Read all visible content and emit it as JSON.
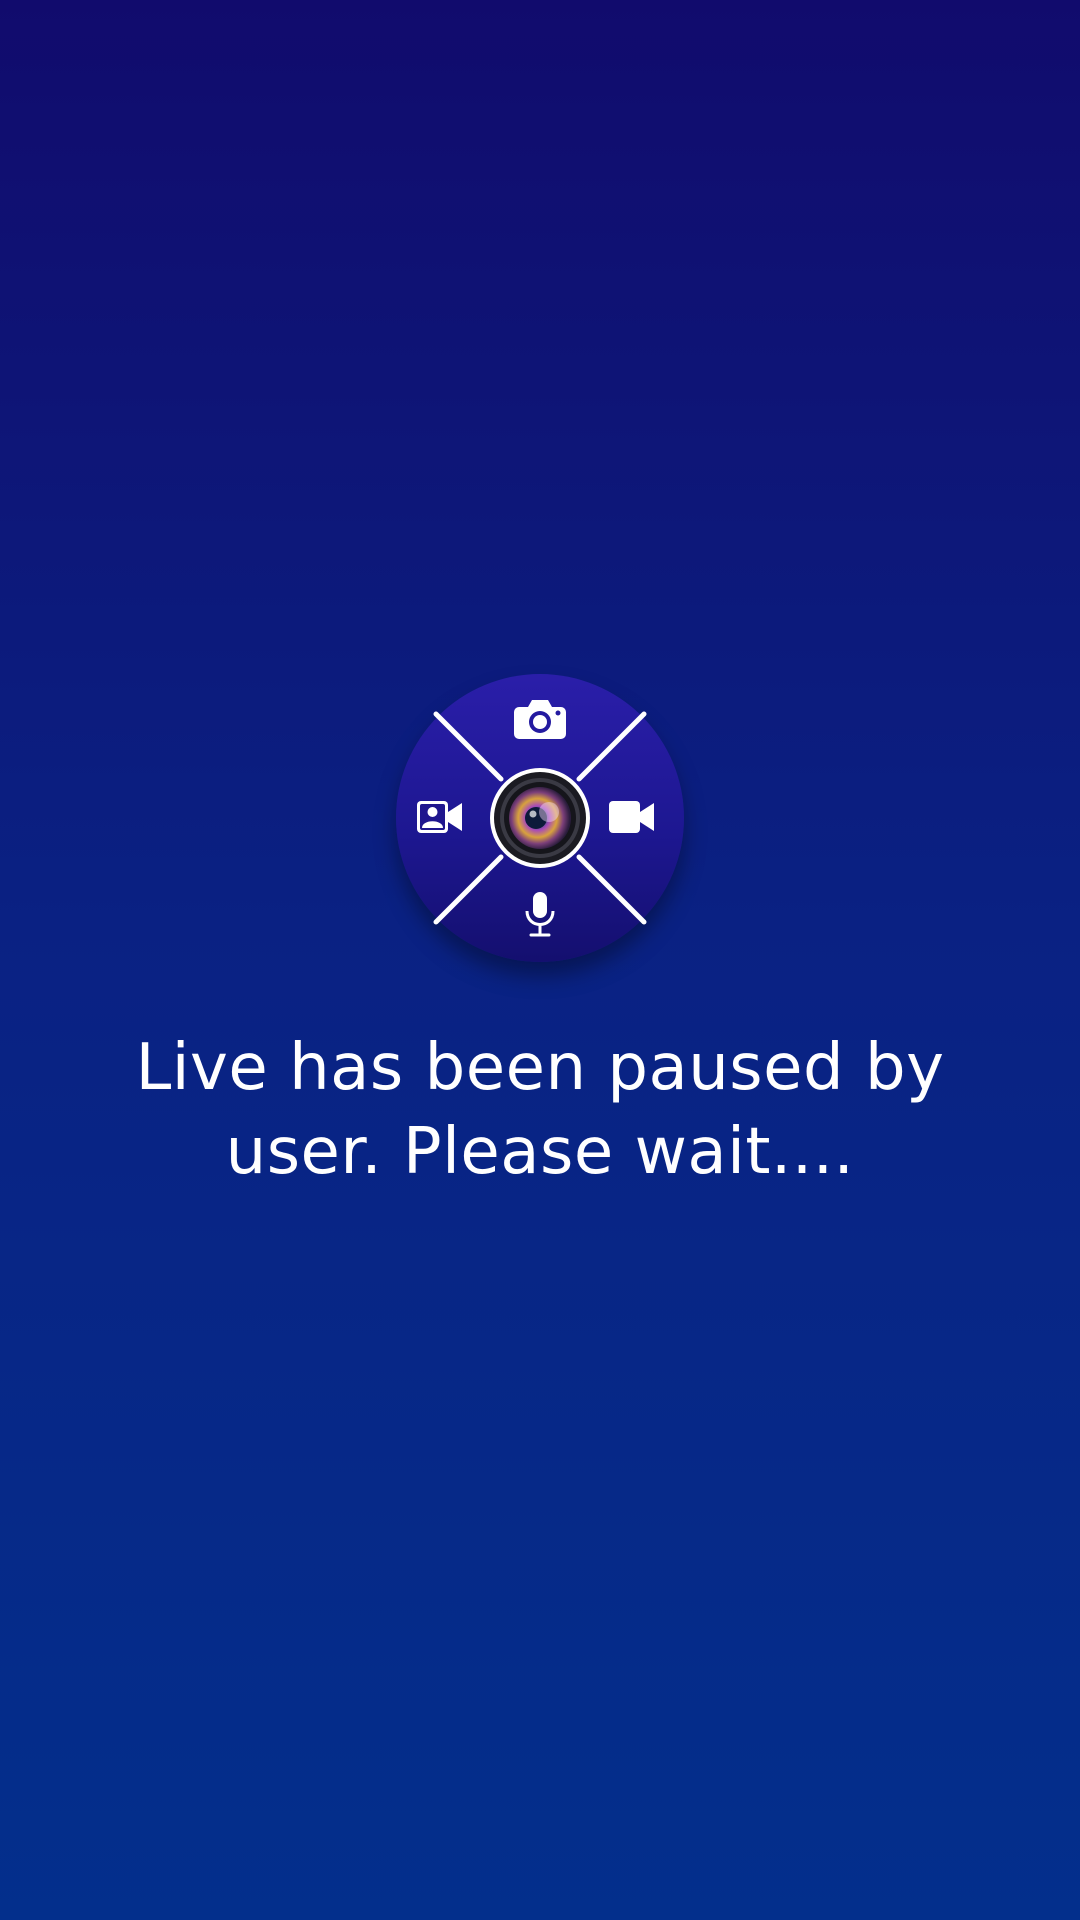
{
  "screen": {
    "background_top": "#110b6d",
    "background_bottom": "#032f8c"
  },
  "logo": {
    "segments": {
      "top_icon": "camera-icon",
      "right_icon": "video-camera-icon",
      "bottom_icon": "microphone-icon",
      "left_icon": "user-video-icon"
    },
    "center_icon": "camera-lens-icon"
  },
  "message": {
    "text": "Live has been paused by user. Please wait...."
  }
}
